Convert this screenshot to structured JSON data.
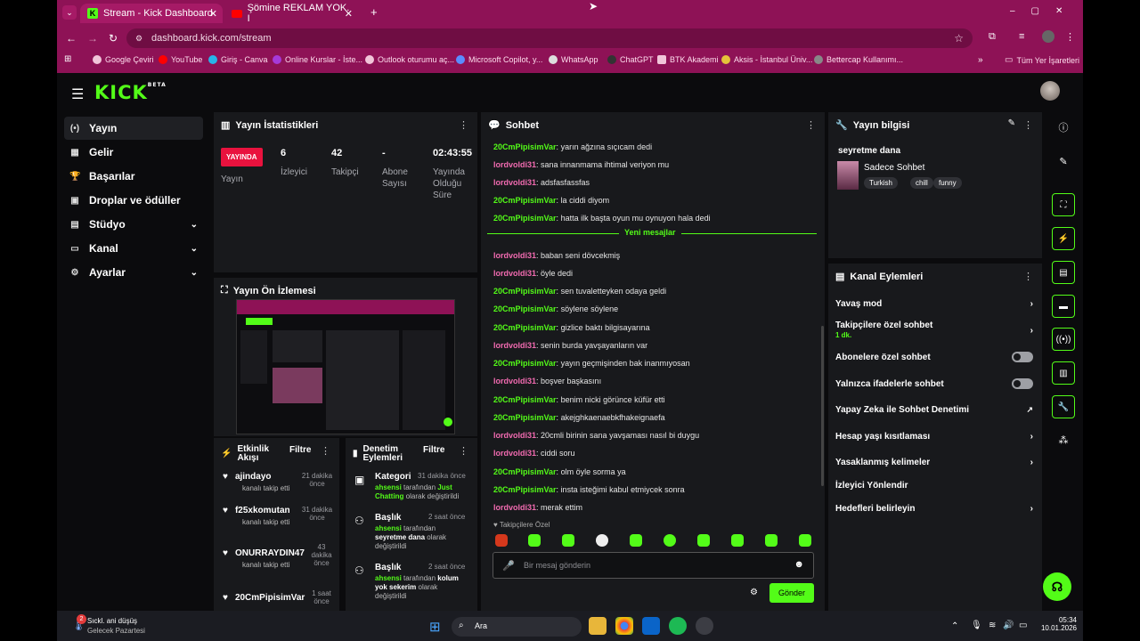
{
  "browser": {
    "tabs": [
      {
        "label": "Stream - Kick Dashboard"
      },
      {
        "label": "Şömine REKLAM YOK. I"
      }
    ],
    "url": "dashboard.kick.com/stream",
    "bookmarks": [
      "Google Çeviri",
      "YouTube",
      "Giriş - Canva",
      "Online Kurslar - İste...",
      "Outlook oturumu aç...",
      "Microsoft Copilot, y...",
      "WhatsApp",
      "ChatGPT",
      "BTK Akademi",
      "Aksis - İstanbul Üniv...",
      "Bettercap Kullanımı..."
    ],
    "all_bookmarks": "Tüm Yer İşaretleri"
  },
  "app": {
    "logo": "KICK",
    "logo_badge": "BETA"
  },
  "sidebar": {
    "items": [
      {
        "label": "Yayın",
        "icon": "(•)"
      },
      {
        "label": "Gelir",
        "icon": "▦"
      },
      {
        "label": "Başarılar",
        "icon": "🏆"
      },
      {
        "label": "Droplar ve ödüller",
        "icon": "▣"
      },
      {
        "label": "Stüdyo",
        "icon": "▤"
      },
      {
        "label": "Kanal",
        "icon": "▭"
      },
      {
        "label": "Ayarlar",
        "icon": "⚙"
      }
    ]
  },
  "stats": {
    "title": "Yayın İstatistikleri",
    "live_badge": "YAYINDA",
    "live_label": "Yayın",
    "viewers_value": "6",
    "viewers_label": "İzleyici",
    "followers_value": "42",
    "followers_label": "Takipçi",
    "subs_value": "-",
    "subs_label": "Abone Sayısı",
    "uptime_value": "02:43:55",
    "uptime_label": "Yayında Olduğu Süre"
  },
  "preview": {
    "title": "Yayın Ön İzlemesi"
  },
  "activity": {
    "title": "Etkinlik Akışı",
    "filter": "Filtre",
    "items": [
      {
        "user": "ajindayo",
        "time": "21 dakika önce",
        "desc": "kanalı takip etti"
      },
      {
        "user": "f25xkomutan",
        "time": "31 dakika önce",
        "desc": "kanalı takip etti"
      },
      {
        "user": "ONURRAYDIN47",
        "time": "43 dakika önce",
        "desc": "kanalı takip etti"
      },
      {
        "user": "20CmPipisimVar",
        "time": "1 saat önce",
        "desc": ""
      }
    ]
  },
  "moderation": {
    "title": "Denetim Eylemleri",
    "filter": "Filtre",
    "items": [
      {
        "kind": "Kategori",
        "time": "31 dakika önce",
        "actor": "ahsensi",
        "mid": "tarafından",
        "value": "Just Chatting",
        "tail": "olarak değiştirildi"
      },
      {
        "kind": "Başlık",
        "time": "2 saat önce",
        "actor": "ahsensi",
        "mid": "tarafından",
        "value": "seyretme dana",
        "tail": "olarak değiştirildi"
      },
      {
        "kind": "Başlık",
        "time": "2 saat önce",
        "actor": "ahsensi",
        "mid": "tarafından",
        "value": "kolum yok sekerim",
        "tail": "olarak değiştirildi"
      }
    ]
  },
  "chat": {
    "title": "Sohbet",
    "new_messages": "Yeni mesajlar",
    "followers_only": "Takipçilere Özel",
    "placeholder": "Bir mesaj gönderin",
    "send": "Gönder",
    "messages": [
      {
        "user": "20CmPipisimVar",
        "text": "yarın ağzına sıçıcam dedi",
        "c": 1
      },
      {
        "user": "lordvoldi31",
        "text": "sana innanmama ihtimal veriyon mu",
        "c": 2
      },
      {
        "user": "lordvoldi31",
        "text": "adsfasfassfas",
        "c": 2
      },
      {
        "user": "20CmPipisimVar",
        "text": "la ciddi diyom",
        "c": 1
      },
      {
        "user": "20CmPipisimVar",
        "text": "hatta ilk başta oyun mu oynuyon hala dedi",
        "c": 1
      },
      {
        "user": "lordvoldi31",
        "text": "baban seni dövcekmiş",
        "c": 2
      },
      {
        "user": "lordvoldi31",
        "text": "öyle dedi",
        "c": 2
      },
      {
        "user": "20CmPipisimVar",
        "text": "sen tuvaletteyken odaya geldi",
        "c": 1
      },
      {
        "user": "20CmPipisimVar",
        "text": "söylene söylene",
        "c": 1
      },
      {
        "user": "20CmPipisimVar",
        "text": "gizlice baktı bilgisayarına",
        "c": 1
      },
      {
        "user": "lordvoldi31",
        "text": "senin burda yavşayanların var",
        "c": 2
      },
      {
        "user": "20CmPipisimVar",
        "text": "yayın geçmişinden bak inanmıyosan",
        "c": 1
      },
      {
        "user": "lordvoldi31",
        "text": "boşver başkasını",
        "c": 2
      },
      {
        "user": "20CmPipisimVar",
        "text": "benim nicki görünce küfür etti",
        "c": 1
      },
      {
        "user": "20CmPipisimVar",
        "text": "akejghkaenaebkfhakeignaefa",
        "c": 1
      },
      {
        "user": "lordvoldi31",
        "text": "20cmli birinin sana yavşaması nasıl bi duygu",
        "c": 2
      },
      {
        "user": "lordvoldi31",
        "text": "ciddi soru",
        "c": 2
      },
      {
        "user": "20CmPipisimVar",
        "text": "olm öyle sorma ya",
        "c": 1
      },
      {
        "user": "20CmPipisimVar",
        "text": "insta isteğimi kabul etmiycek sonra",
        "c": 1
      },
      {
        "user": "lordvoldi31",
        "text": "merak ettim",
        "c": 2
      }
    ]
  },
  "stream_info": {
    "title": "Yayın bilgisi",
    "stream_title": "seyretme dana",
    "category": "Sadece Sohbet",
    "tags": [
      "Turkish",
      "chill",
      "funny"
    ]
  },
  "channel_actions": {
    "title": "Kanal Eylemleri",
    "items": [
      {
        "label": "Yavaş mod",
        "sub": ""
      },
      {
        "label": "Takipçilere özel sohbet",
        "sub": "1 dk."
      },
      {
        "label": "Abonelere özel sohbet",
        "sub": ""
      },
      {
        "label": "Yalnızca ifadelerle sohbet",
        "sub": ""
      },
      {
        "label": "Yapay Zeka ile Sohbet Denetimi",
        "sub": ""
      },
      {
        "label": "Hesap yaşı kısıtlaması",
        "sub": ""
      },
      {
        "label": "Yasaklanmış kelimeler",
        "sub": ""
      },
      {
        "label": "İzleyici Yönlendir",
        "sub": ""
      },
      {
        "label": "Hedefleri belirleyin",
        "sub": ""
      }
    ]
  },
  "taskbar": {
    "weather_title": "Sıckl. ani düşüş",
    "weather_sub": "Gelecek Pazartesi",
    "weather_badge": "2",
    "search": "Ara",
    "time": "05:34",
    "date": "10.01.2026"
  },
  "colors": {
    "accent": "#53fc18",
    "browser": "#8e1256",
    "panel": "#18191c"
  }
}
